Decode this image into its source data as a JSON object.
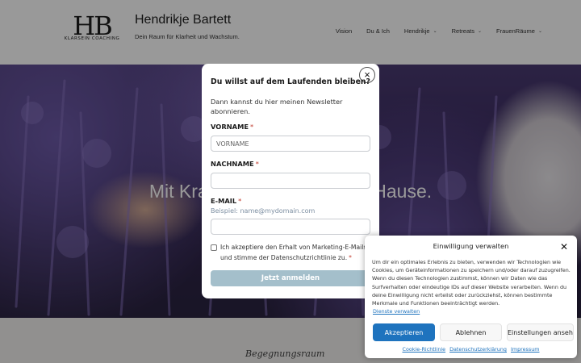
{
  "header": {
    "logo_letters": "HB",
    "logo_tagline": "KLARSEIN COACHING",
    "site_title": "Hendrikje Bartett",
    "tagline": "Dein Raum für Klarheit und Wachstum.",
    "nav": [
      {
        "label": "Vision",
        "has_dropdown": false
      },
      {
        "label": "Du & Ich",
        "has_dropdown": false
      },
      {
        "label": "Hendrikje",
        "has_dropdown": true
      },
      {
        "label": "Retreats",
        "has_dropdown": true
      },
      {
        "label": "FrauenRäume",
        "has_dropdown": true
      }
    ]
  },
  "hero": {
    "heading": "Mit Kraft und Klarheit nach Hause."
  },
  "lower": {
    "script_heading": "Begegnungsraum"
  },
  "newsletter": {
    "title": "Du willst auf dem Laufenden bleiben?",
    "intro": "Dann kannst du hier meinen Newsletter abonnieren.",
    "firstname_label": "VORNAME",
    "firstname_placeholder": "VORNAME",
    "lastname_label": "NACHNAME",
    "lastname_value": "",
    "email_label": "E-MAIL",
    "email_hint": "Beispiel: name@mydomain.com",
    "email_value": "",
    "required_mark": "*",
    "consent_text": "Ich akzeptiere den Erhalt von Marketing-E-Mails und stimme der Datenschutzrichtlinie zu.",
    "consent_checked": false,
    "submit_label": "Jetzt anmelden",
    "close_symbol": "×"
  },
  "cookie": {
    "title": "Einwilligung verwalten",
    "close_symbol": "✕",
    "text": "Um dir ein optimales Erlebnis zu bieten, verwenden wir Technologien wie Cookies, um Geräteinformationen zu speichern und/oder darauf zuzugreifen. Wenn du diesen Technologien zustimmst, können wir Daten wie das Surfverhalten oder eindeutige IDs auf dieser Website verarbeiten. Wenn du deine Einwilligung nicht erteilst oder zurückziehst, können bestimmte Merkmale und Funktionen beeinträchtigt werden.",
    "services_link": "Dienste verwalten",
    "accept_label": "Akzeptieren",
    "deny_label": "Ablehnen",
    "settings_label": "Einstellungen ansehen",
    "footer_links": [
      "Cookie-Richtlinie",
      "Datenschutzerklärung",
      "Impressum"
    ]
  },
  "colors": {
    "accent": "#1e73be",
    "submit_button": "#a4bfcb",
    "required": "#c0392b"
  }
}
